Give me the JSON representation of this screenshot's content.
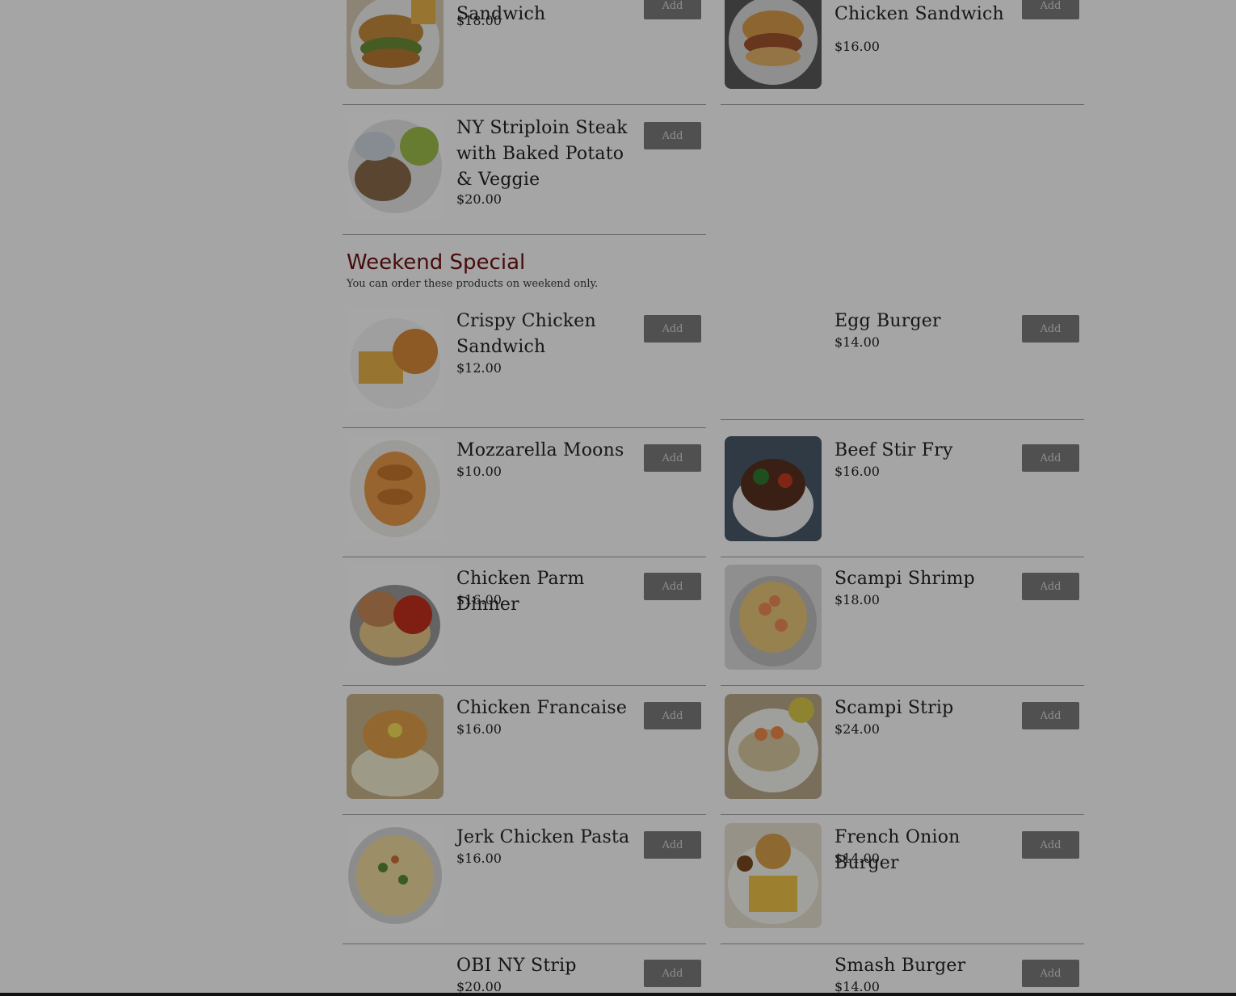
{
  "top_items": [
    {
      "name": "Crabcake Sandwich",
      "price": "$18.00",
      "add": "Add",
      "image": "crabcake-sandwich-photo"
    },
    {
      "name": "Angry Bird Chicken Sandwich",
      "price": "$16.00",
      "add": "Add",
      "image": "chicken-sandwich-photo"
    },
    {
      "name": "NY Striploin Steak with Baked Potato & Veggie",
      "price": "$20.00",
      "add": "Add",
      "image": "steak-potato-photo"
    }
  ],
  "section": {
    "title": "Weekend Special",
    "subtitle": "You can order these products on weekend only."
  },
  "items": [
    {
      "name": "Crispy Chicken Sandwich",
      "price": "$12.00",
      "add": "Add",
      "image": "chicken-sandwich-fries-photo"
    },
    {
      "name": "Egg Burger",
      "price": "$14.00",
      "add": "Add",
      "image": ""
    },
    {
      "name": "Mozzarella Moons",
      "price": "$10.00",
      "add": "Add",
      "image": "mozzarella-moons-photo"
    },
    {
      "name": "Beef Stir Fry",
      "price": "$16.00",
      "add": "Add",
      "image": "beef-stir-fry-photo"
    },
    {
      "name": "Chicken Parm Dinner",
      "price": "$16.00",
      "add": "Add",
      "image": "chicken-parm-photo"
    },
    {
      "name": "Scampi Shrimp",
      "price": "$18.00",
      "add": "Add",
      "image": "scampi-shrimp-photo"
    },
    {
      "name": "Chicken Francaise",
      "price": "$16.00",
      "add": "Add",
      "image": "chicken-francaise-photo"
    },
    {
      "name": "Scampi Strip",
      "price": "$24.00",
      "add": "Add",
      "image": "scampi-strip-photo"
    },
    {
      "name": "Jerk Chicken Pasta",
      "price": "$16.00",
      "add": "Add",
      "image": "jerk-chicken-pasta-photo"
    },
    {
      "name": "French Onion Burger",
      "price": "$14.00",
      "add": "Add",
      "image": "burger-fries-photo"
    },
    {
      "name": "OBI NY Strip",
      "price": "$20.00",
      "add": "Add",
      "image": ""
    },
    {
      "name": "Smash Burger",
      "price": "$14.00",
      "add": "Add",
      "image": ""
    }
  ]
}
